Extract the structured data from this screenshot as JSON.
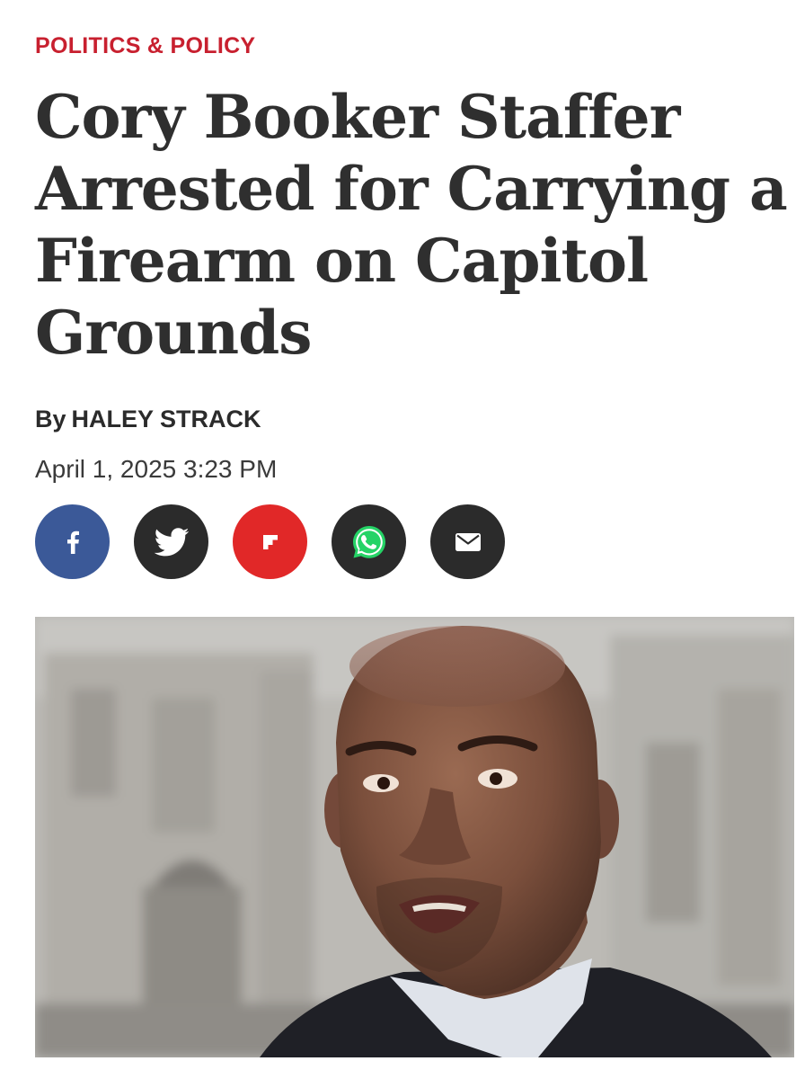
{
  "article": {
    "category": "POLITICS & POLICY",
    "headline": "Cory Booker Staffer Arrested for Carrying a Firearm on Capitol Grounds",
    "byline_prefix": "By",
    "author": "HALEY STRACK",
    "date": "April 1, 2025 3:23 PM"
  },
  "share": [
    {
      "network": "facebook",
      "icon": "facebook-icon",
      "color": "#3b5998"
    },
    {
      "network": "twitter",
      "icon": "twitter-icon",
      "color": "#2b2b2b"
    },
    {
      "network": "flipboard",
      "icon": "flipboard-icon",
      "color": "#e12828"
    },
    {
      "network": "whatsapp",
      "icon": "whatsapp-icon",
      "color": "#2b2b2b"
    },
    {
      "network": "email",
      "icon": "mail-icon",
      "color": "#2b2b2b"
    }
  ],
  "colors": {
    "category": "#c8202f",
    "headline": "#2f2f2f"
  }
}
